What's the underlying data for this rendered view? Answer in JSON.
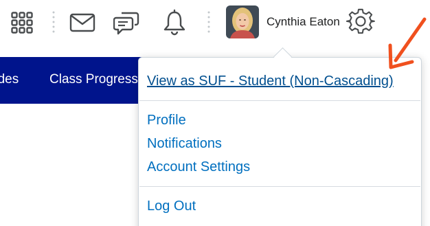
{
  "header": {
    "user_name": "Cynthia Eaton",
    "icons": [
      "apps-grid-icon",
      "mail-icon",
      "chat-icon",
      "bell-icon",
      "avatar",
      "gear-icon"
    ]
  },
  "course_nav": {
    "items": [
      {
        "label": "ades"
      },
      {
        "label": "Class Progress"
      }
    ],
    "background": "#00148c"
  },
  "dropdown": {
    "view_as": "View as SUF - Student (Non-Cascading)",
    "items": [
      {
        "label": "Profile"
      },
      {
        "label": "Notifications"
      },
      {
        "label": "Account Settings"
      }
    ],
    "logout": "Log Out"
  },
  "colors": {
    "link": "#006fbf",
    "annotation_arrow": "#f0501e"
  }
}
